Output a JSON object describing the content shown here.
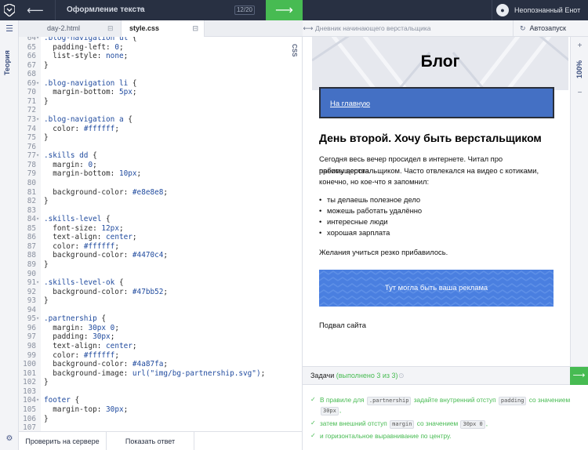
{
  "topbar": {
    "course_title": "Оформление текста",
    "progress": "12/20",
    "username": "Неопознанный Енот"
  },
  "sidebar": {
    "theory_label": "Теория"
  },
  "editor": {
    "tabs": [
      {
        "label": "day-2.html"
      },
      {
        "label": "style.css"
      }
    ],
    "side_label": "CSS",
    "lines": [
      {
        "n": "64",
        "fold": "▾",
        "segs": [
          [
            ".blog-navigation ",
            "sel"
          ],
          [
            "ul",
            "sel"
          ],
          [
            " {",
            "punc"
          ]
        ]
      },
      {
        "n": "65",
        "segs": [
          [
            "  padding-left",
            "prop"
          ],
          [
            ": ",
            "punc"
          ],
          [
            "0",
            "num"
          ],
          [
            ";",
            "punc"
          ]
        ]
      },
      {
        "n": "66",
        "segs": [
          [
            "  list-style",
            "prop"
          ],
          [
            ": ",
            "punc"
          ],
          [
            "none",
            "val"
          ],
          [
            ";",
            "punc"
          ]
        ]
      },
      {
        "n": "67",
        "segs": [
          [
            "}",
            "punc"
          ]
        ]
      },
      {
        "n": "68",
        "segs": []
      },
      {
        "n": "69",
        "fold": "▾",
        "segs": [
          [
            ".blog-navigation li",
            "sel"
          ],
          [
            " {",
            "punc"
          ]
        ]
      },
      {
        "n": "70",
        "segs": [
          [
            "  margin-bottom",
            "prop"
          ],
          [
            ": ",
            "punc"
          ],
          [
            "5px",
            "num"
          ],
          [
            ";",
            "punc"
          ]
        ]
      },
      {
        "n": "71",
        "segs": [
          [
            "}",
            "punc"
          ]
        ]
      },
      {
        "n": "72",
        "segs": []
      },
      {
        "n": "73",
        "fold": "▾",
        "segs": [
          [
            ".blog-navigation a",
            "sel"
          ],
          [
            " {",
            "punc"
          ]
        ]
      },
      {
        "n": "74",
        "segs": [
          [
            "  color",
            "prop"
          ],
          [
            ": ",
            "punc"
          ],
          [
            "#ffffff",
            "hex"
          ],
          [
            ";",
            "punc"
          ]
        ]
      },
      {
        "n": "75",
        "segs": [
          [
            "}",
            "punc"
          ]
        ]
      },
      {
        "n": "76",
        "segs": []
      },
      {
        "n": "77",
        "fold": "▾",
        "segs": [
          [
            ".skills dd",
            "sel"
          ],
          [
            " {",
            "punc"
          ]
        ]
      },
      {
        "n": "78",
        "segs": [
          [
            "  margin",
            "prop"
          ],
          [
            ": ",
            "punc"
          ],
          [
            "0",
            "num"
          ],
          [
            ";",
            "punc"
          ]
        ]
      },
      {
        "n": "79",
        "segs": [
          [
            "  margin-bottom",
            "prop"
          ],
          [
            ": ",
            "punc"
          ],
          [
            "10px",
            "num"
          ],
          [
            ";",
            "punc"
          ]
        ]
      },
      {
        "n": "80",
        "segs": []
      },
      {
        "n": "81",
        "segs": [
          [
            "  background-color",
            "prop"
          ],
          [
            ": ",
            "punc"
          ],
          [
            "#e8e8e8",
            "hex"
          ],
          [
            ";",
            "punc"
          ]
        ]
      },
      {
        "n": "82",
        "segs": [
          [
            "}",
            "punc"
          ]
        ]
      },
      {
        "n": "83",
        "segs": []
      },
      {
        "n": "84",
        "fold": "▾",
        "segs": [
          [
            ".skills-level",
            "sel"
          ],
          [
            " {",
            "punc"
          ]
        ]
      },
      {
        "n": "85",
        "segs": [
          [
            "  font-size",
            "prop"
          ],
          [
            ": ",
            "punc"
          ],
          [
            "12px",
            "num"
          ],
          [
            ";",
            "punc"
          ]
        ]
      },
      {
        "n": "86",
        "segs": [
          [
            "  text-align",
            "prop"
          ],
          [
            ": ",
            "punc"
          ],
          [
            "center",
            "val"
          ],
          [
            ";",
            "punc"
          ]
        ]
      },
      {
        "n": "87",
        "segs": [
          [
            "  color",
            "prop"
          ],
          [
            ": ",
            "punc"
          ],
          [
            "#ffffff",
            "hex"
          ],
          [
            ";",
            "punc"
          ]
        ]
      },
      {
        "n": "88",
        "segs": [
          [
            "  background-color",
            "prop"
          ],
          [
            ": ",
            "punc"
          ],
          [
            "#4470c4",
            "hex"
          ],
          [
            ";",
            "punc"
          ]
        ]
      },
      {
        "n": "89",
        "segs": [
          [
            "}",
            "punc"
          ]
        ]
      },
      {
        "n": "90",
        "segs": []
      },
      {
        "n": "91",
        "fold": "▾",
        "segs": [
          [
            ".skills-level-ok",
            "sel"
          ],
          [
            " {",
            "punc"
          ]
        ]
      },
      {
        "n": "92",
        "segs": [
          [
            "  background-color",
            "prop"
          ],
          [
            ": ",
            "punc"
          ],
          [
            "#47bb52",
            "hex"
          ],
          [
            ";",
            "punc"
          ]
        ]
      },
      {
        "n": "93",
        "segs": [
          [
            "}",
            "punc"
          ]
        ]
      },
      {
        "n": "94",
        "segs": []
      },
      {
        "n": "95",
        "fold": "▾",
        "segs": [
          [
            ".partnership",
            "sel"
          ],
          [
            " {",
            "punc"
          ]
        ]
      },
      {
        "n": "96",
        "segs": [
          [
            "  margin",
            "prop"
          ],
          [
            ": ",
            "punc"
          ],
          [
            "30px 0",
            "num"
          ],
          [
            ";",
            "punc"
          ]
        ]
      },
      {
        "n": "97",
        "segs": [
          [
            "  padding",
            "prop"
          ],
          [
            ": ",
            "punc"
          ],
          [
            "30px",
            "num"
          ],
          [
            ";",
            "punc"
          ]
        ]
      },
      {
        "n": "98",
        "segs": [
          [
            "  text-align",
            "prop"
          ],
          [
            ": ",
            "punc"
          ],
          [
            "center",
            "val"
          ],
          [
            ";",
            "punc"
          ]
        ]
      },
      {
        "n": "99",
        "segs": [
          [
            "  color",
            "prop"
          ],
          [
            ": ",
            "punc"
          ],
          [
            "#ffffff",
            "hex"
          ],
          [
            ";",
            "punc"
          ]
        ]
      },
      {
        "n": "100",
        "segs": [
          [
            "  background-color",
            "prop"
          ],
          [
            ": ",
            "punc"
          ],
          [
            "#4a87fa",
            "hex"
          ],
          [
            ";",
            "punc"
          ]
        ]
      },
      {
        "n": "101",
        "segs": [
          [
            "  background-image",
            "prop"
          ],
          [
            ": ",
            "punc"
          ],
          [
            "url(\"img/bg-partnership.svg\")",
            "val"
          ],
          [
            ";",
            "punc"
          ]
        ]
      },
      {
        "n": "102",
        "segs": [
          [
            "}",
            "punc"
          ]
        ]
      },
      {
        "n": "103",
        "segs": []
      },
      {
        "n": "104",
        "fold": "▾",
        "segs": [
          [
            "footer",
            "sel"
          ],
          [
            " {",
            "punc"
          ]
        ]
      },
      {
        "n": "105",
        "segs": [
          [
            "  margin-top",
            "prop"
          ],
          [
            ": ",
            "punc"
          ],
          [
            "30px",
            "num"
          ],
          [
            ";",
            "punc"
          ]
        ]
      },
      {
        "n": "106",
        "segs": [
          [
            "}",
            "punc"
          ]
        ]
      },
      {
        "n": "107",
        "segs": []
      }
    ],
    "check_button": "Проверить на сервере",
    "answer_button": "Показать ответ"
  },
  "preview": {
    "header_title": "Дневник начинающего верстальщика",
    "autorun_label": "Автозапуск",
    "blog_title": "Блог",
    "nav_link": "На главную",
    "heading": "День второй. Хочу быть верстальщиком",
    "paragraph_lines": [
      "Сегодня весь вечер просидел в интернете. Читал про преимущества",
      "работы верстальщиком. Часто отвлекался на видео с котиками,",
      "конечно, но кое-что я запомнил:"
    ],
    "list_items": [
      "ты делаешь полезное дело",
      "можешь работать удалённо",
      "интересные люди",
      "хорошая зарплата"
    ],
    "paragraph2": "Желания учиться резко прибавилось.",
    "ad_text": "Тут могла быть ваша реклама",
    "footer_text": "Подвал сайта",
    "zoom": "100%"
  },
  "tasks": {
    "title": "Задачи",
    "status": "(выполнено 3 из 3)",
    "items": [
      {
        "parts": [
          "В правиле для ",
          ".partnership",
          " задайте внутренний отступ ",
          "padding",
          " со значением"
        ],
        "line2": [
          "30px",
          ","
        ]
      },
      {
        "parts": [
          "затем внешний отступ ",
          "margin",
          " со значением ",
          "30px 0",
          ","
        ]
      },
      {
        "parts": [
          "и горизонтальное выравнивание по центру."
        ]
      }
    ]
  },
  "colors": {
    "topbar": "#283042",
    "accent_green": "#47bb52",
    "nav_blue": "#4470c4",
    "ad_blue": "#4a87fa"
  }
}
